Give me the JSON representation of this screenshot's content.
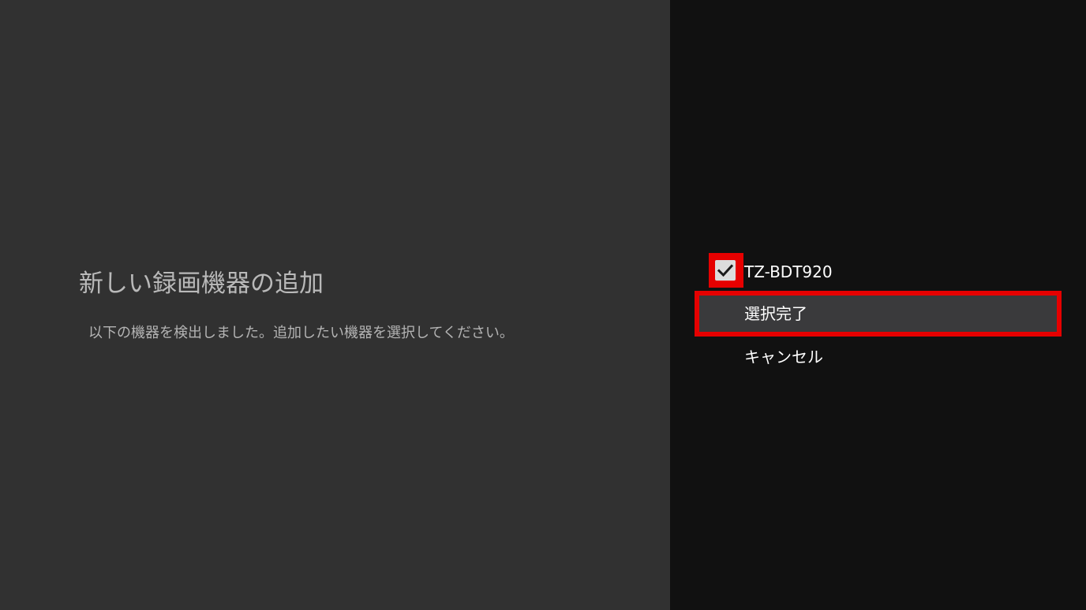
{
  "dialog": {
    "title": "新しい録画機器の追加",
    "description": "以下の機器を検出しました。追加したい機器を選択してください。"
  },
  "options": {
    "device": {
      "label": "TZ-BDT920",
      "checked": true,
      "icon": "checkmark-icon"
    },
    "confirm": {
      "label": "選択完了"
    },
    "cancel": {
      "label": "キャンセル"
    }
  },
  "colors": {
    "left_panel_bg": "#313131",
    "right_panel_bg": "#111111",
    "highlight_border": "#e60000",
    "focused_item_bg": "#3a3a3c",
    "checkbox_fill": "#dcdcdc"
  }
}
